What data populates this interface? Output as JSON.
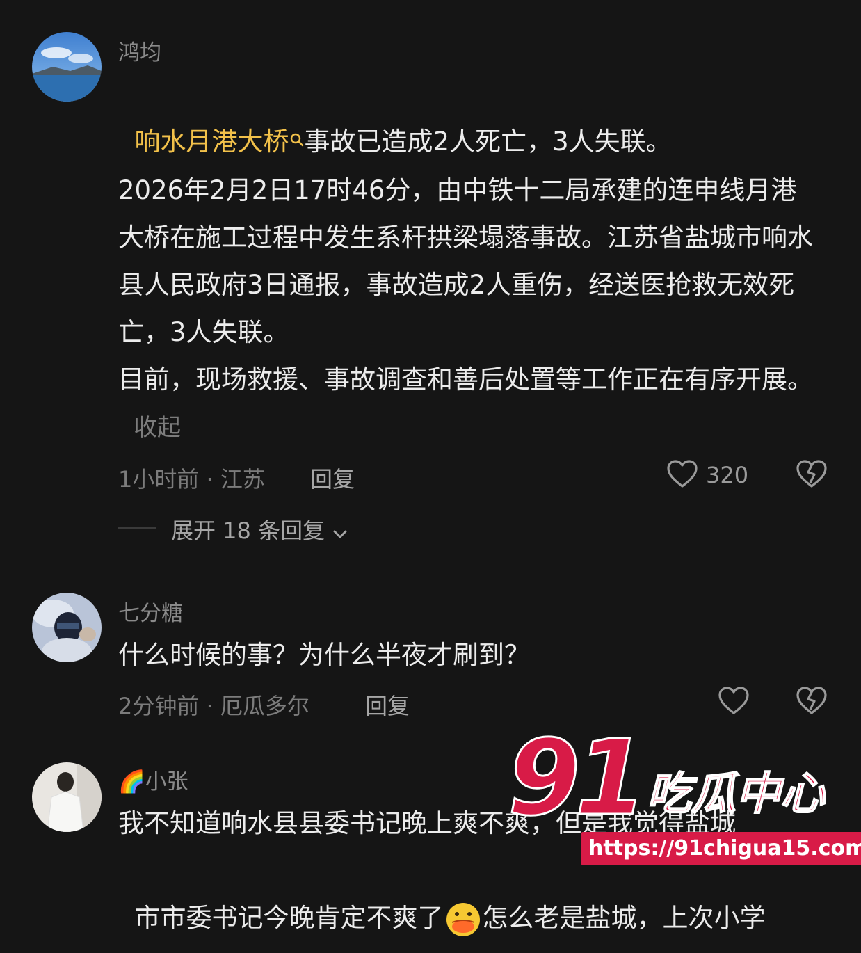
{
  "comments": [
    {
      "username": "鸿均",
      "highlight": "响水月港大桥",
      "text_after_highlight": "事故已造成2人死亡，3人失联。",
      "paragraph_1": "2026年2月2日17时46分，由中铁十二局承建的连申线月港大桥在施工过程中发生系杆拱梁塌落事故。江苏省盐城市响水县人民政府3日通报，事故造成2人重伤，经送医抢救无效死亡，3人失联。",
      "paragraph_2": "目前，现场救援、事故调查和善后处置等工作正在有序开展。",
      "collapse_label": "收起",
      "meta": "1小时前 · 江苏",
      "reply_label": "回复",
      "like_count": "320",
      "expand_label": "展开 18 条回复"
    },
    {
      "username": "七分糖",
      "text": "什么时候的事？为什么半夜才刷到？",
      "meta": "2分钟前 · 厄瓜多尔",
      "reply_label": "回复"
    },
    {
      "username": "小张",
      "username_prefix_emoji": "🌈",
      "text_line_1": "我不知道响水县县委书记晚上爽不爽，但是我觉得盐城",
      "text_line_2_a": "市市委书记今晚肯定不爽了",
      "text_line_2_b": "怎么老是盐城，上次小学"
    }
  ],
  "watermark": {
    "number": "91",
    "brand": "吃瓜中心",
    "url": "https://91chigua15.com",
    "color": "#d81b47"
  },
  "icons": [
    "search-icon",
    "heart-icon",
    "dislike-heart-icon",
    "chevron-down-icon",
    "avatar",
    "emoji"
  ]
}
